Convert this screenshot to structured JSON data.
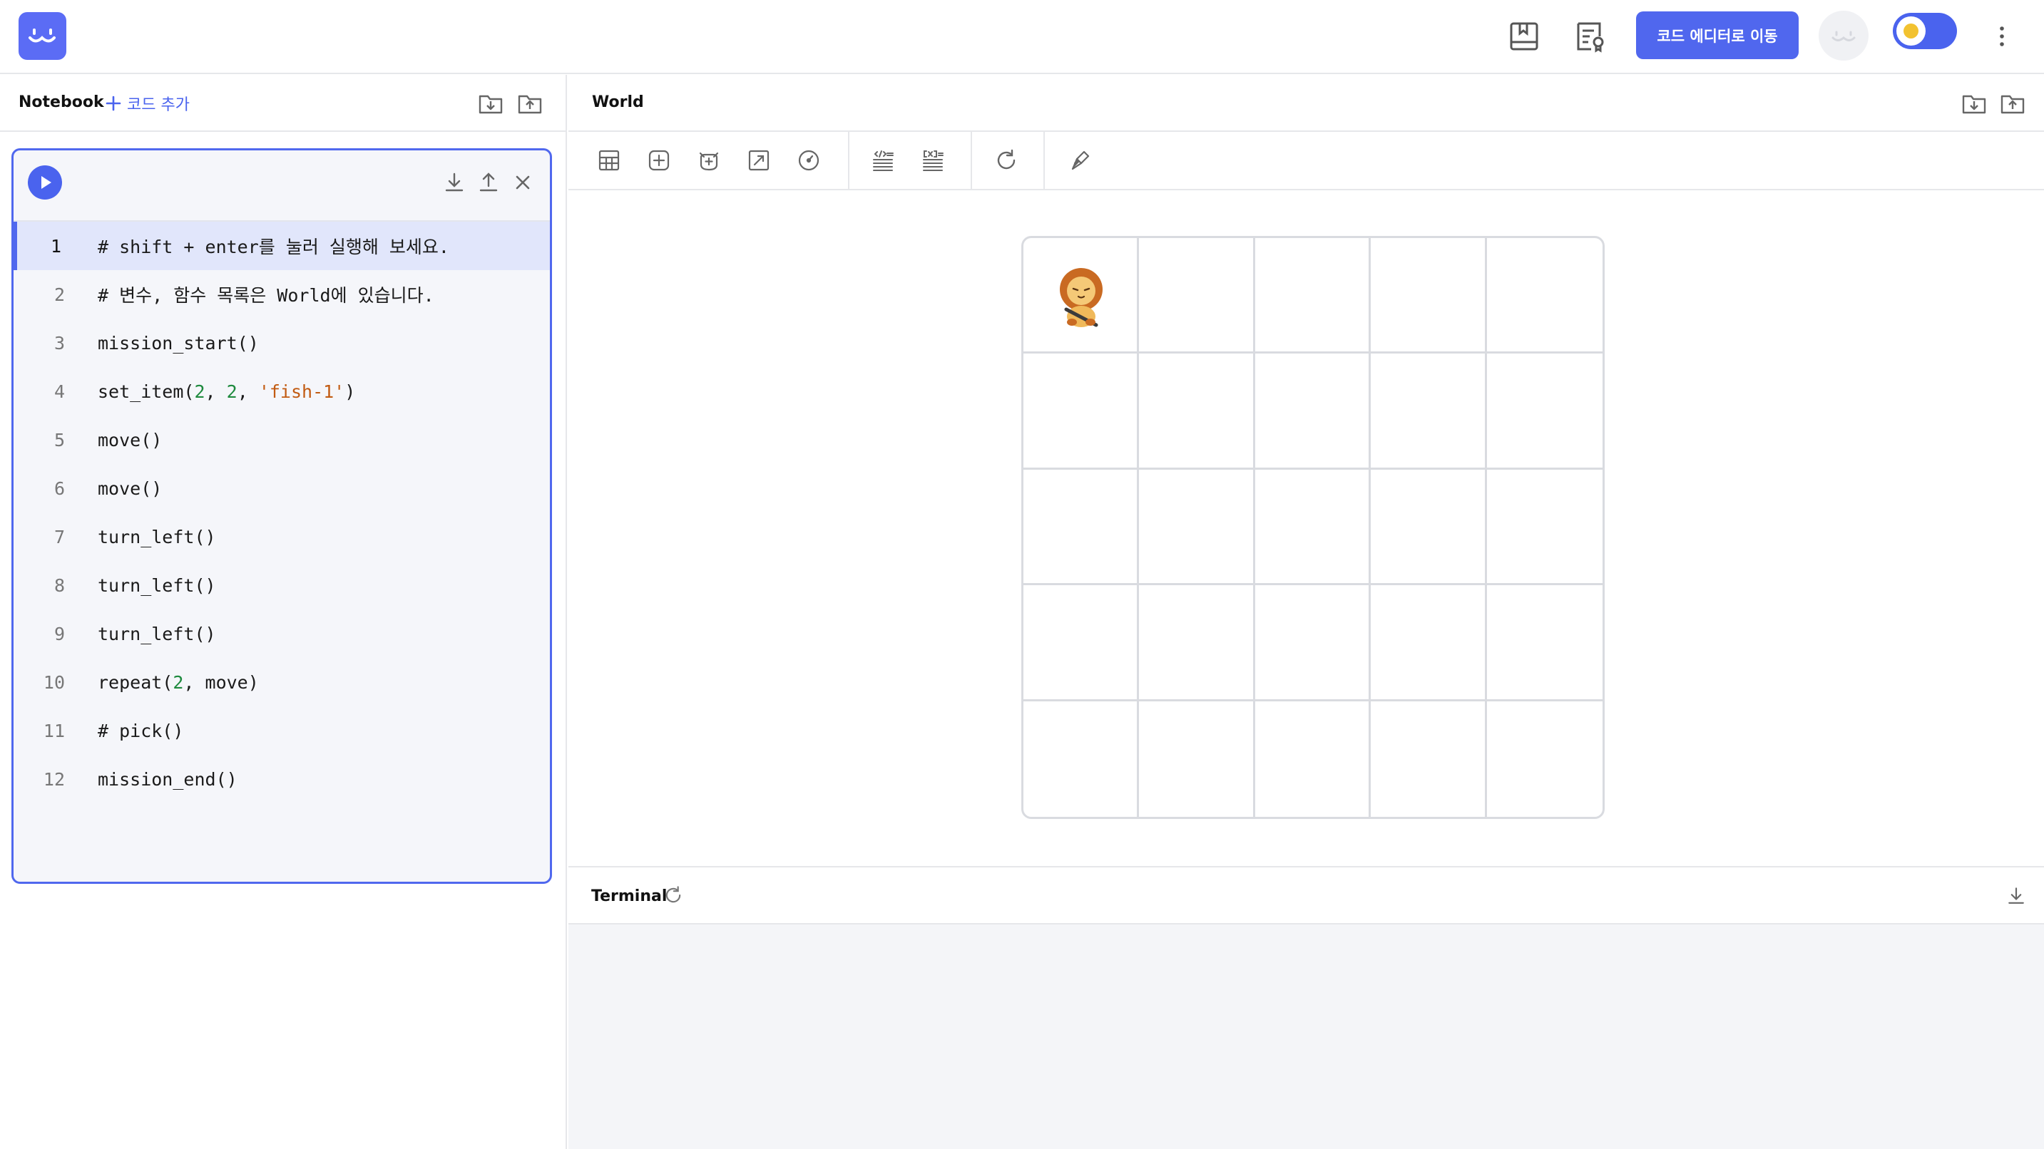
{
  "header": {
    "editor_button": "코드 에디터로 이동",
    "icons": [
      "book-icon",
      "certificate-icon",
      "avatar-icon",
      "theme-toggle",
      "more-icon"
    ],
    "accent_color": "#5067ee"
  },
  "notebook": {
    "title": "Notebook",
    "add_code": "코드 추가",
    "code_lines": [
      {
        "n": "1",
        "text": "# shift + enter를 눌러 실행해 보세요."
      },
      {
        "n": "2",
        "text": "# 변수, 함수 목록은 World에 있습니다."
      },
      {
        "n": "3",
        "text": "mission_start()"
      },
      {
        "n": "4",
        "text": "set_item(2, 2, 'fish-1')"
      },
      {
        "n": "5",
        "text": "move()"
      },
      {
        "n": "6",
        "text": "move()"
      },
      {
        "n": "7",
        "text": "turn_left()"
      },
      {
        "n": "8",
        "text": "turn_left()"
      },
      {
        "n": "9",
        "text": "turn_left()"
      },
      {
        "n": "10",
        "text": "repeat(2, move)"
      },
      {
        "n": "11",
        "text": "# pick()"
      },
      {
        "n": "12",
        "text": "mission_end()"
      }
    ]
  },
  "world": {
    "title": "World",
    "grid_rows": 5,
    "grid_cols": 5,
    "character": "lion-character",
    "character_cell": [
      1,
      1
    ]
  },
  "terminal": {
    "title": "Terminal"
  }
}
